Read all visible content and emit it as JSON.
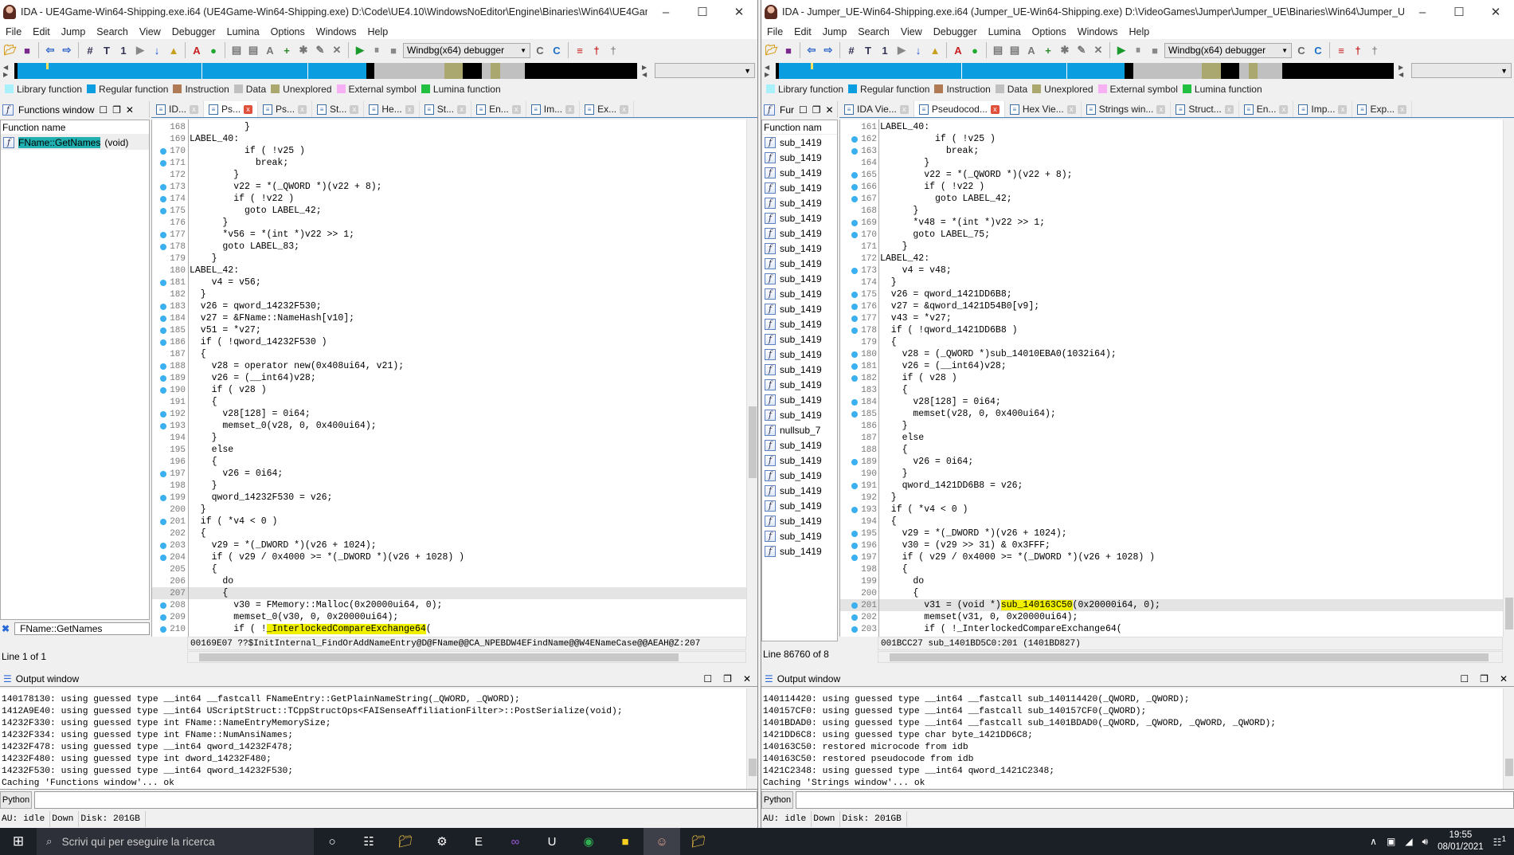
{
  "windows": [
    {
      "title": "IDA - UE4Game-Win64-Shipping.exe.i64 (UE4Game-Win64-Shipping.exe) D:\\Code\\UE4.10\\WindowsNoEditor\\Engine\\Binaries\\Win64\\UE4Game-Win...",
      "menu": [
        "File",
        "Edit",
        "Jump",
        "Search",
        "View",
        "Debugger",
        "Lumina",
        "Options",
        "Windows",
        "Help"
      ],
      "debugger": "Windbg(x64) debugger",
      "panel_title": "Functions window",
      "tabs": [
        {
          "label": "ID...",
          "icon": "ida-view-icon"
        },
        {
          "label": "Ps...",
          "icon": "pseudocode-icon",
          "active": true
        },
        {
          "label": "Ps...",
          "icon": "pseudocode-icon"
        },
        {
          "label": "St...",
          "icon": "strings-icon"
        },
        {
          "label": "He...",
          "icon": "hex-view-icon"
        },
        {
          "label": "St...",
          "icon": "structures-icon"
        },
        {
          "label": "En...",
          "icon": "enums-icon"
        },
        {
          "label": "Im...",
          "icon": "imports-icon"
        },
        {
          "label": "Ex...",
          "icon": "exports-icon"
        }
      ],
      "functions": {
        "header": "Function name",
        "items": [
          {
            "name": "FName::GetNames",
            "suffix": "(void)",
            "selected": true
          }
        ],
        "filter": "FName::GetNames",
        "line_info": "Line 1 of 1"
      },
      "code": [
        {
          "n": "168",
          "bp": false,
          "t": "          }"
        },
        {
          "n": "169",
          "bp": false,
          "t": "LABEL_40:"
        },
        {
          "n": "170",
          "bp": true,
          "t": "          if ( !v25 )"
        },
        {
          "n": "171",
          "bp": true,
          "t": "            break;"
        },
        {
          "n": "172",
          "bp": false,
          "t": "        }"
        },
        {
          "n": "173",
          "bp": true,
          "t": "        v22 = *(_QWORD *)(v22 + 8);"
        },
        {
          "n": "174",
          "bp": true,
          "t": "        if ( !v22 )"
        },
        {
          "n": "175",
          "bp": true,
          "t": "          goto LABEL_42;"
        },
        {
          "n": "176",
          "bp": false,
          "t": "      }"
        },
        {
          "n": "177",
          "bp": true,
          "t": "      *v56 = *(int *)v22 >> 1;"
        },
        {
          "n": "178",
          "bp": true,
          "t": "      goto LABEL_83;"
        },
        {
          "n": "179",
          "bp": false,
          "t": "    }"
        },
        {
          "n": "180",
          "bp": false,
          "t": "LABEL_42:"
        },
        {
          "n": "181",
          "bp": true,
          "t": "    v4 = v56;"
        },
        {
          "n": "182",
          "bp": false,
          "t": "  }"
        },
        {
          "n": "183",
          "bp": true,
          "t": "  v26 = qword_14232F530;"
        },
        {
          "n": "184",
          "bp": true,
          "t": "  v27 = &FName::NameHash[v10];"
        },
        {
          "n": "185",
          "bp": true,
          "t": "  v51 = *v27;"
        },
        {
          "n": "186",
          "bp": true,
          "t": "  if ( !qword_14232F530 )"
        },
        {
          "n": "187",
          "bp": false,
          "t": "  {"
        },
        {
          "n": "188",
          "bp": true,
          "t": "    v28 = operator new(0x408ui64, v21);"
        },
        {
          "n": "189",
          "bp": true,
          "t": "    v26 = (__int64)v28;"
        },
        {
          "n": "190",
          "bp": true,
          "t": "    if ( v28 )"
        },
        {
          "n": "191",
          "bp": false,
          "t": "    {"
        },
        {
          "n": "192",
          "bp": true,
          "t": "      v28[128] = 0i64;"
        },
        {
          "n": "193",
          "bp": true,
          "t": "      memset_0(v28, 0, 0x400ui64);"
        },
        {
          "n": "194",
          "bp": false,
          "t": "    }"
        },
        {
          "n": "195",
          "bp": false,
          "t": "    else"
        },
        {
          "n": "196",
          "bp": false,
          "t": "    {"
        },
        {
          "n": "197",
          "bp": true,
          "t": "      v26 = 0i64;"
        },
        {
          "n": "198",
          "bp": false,
          "t": "    }"
        },
        {
          "n": "199",
          "bp": true,
          "t": "    qword_14232F530 = v26;"
        },
        {
          "n": "200",
          "bp": false,
          "t": "  }"
        },
        {
          "n": "201",
          "bp": true,
          "t": "  if ( *v4 < 0 )"
        },
        {
          "n": "202",
          "bp": false,
          "t": "  {"
        },
        {
          "n": "203",
          "bp": true,
          "t": "    v29 = *(_DWORD *)(v26 + 1024);"
        },
        {
          "n": "204",
          "bp": true,
          "t": "    if ( v29 / 0x4000 >= *(_DWORD *)(v26 + 1028) )"
        },
        {
          "n": "205",
          "bp": false,
          "t": "    {"
        },
        {
          "n": "206",
          "bp": false,
          "t": "      do"
        },
        {
          "n": "207",
          "bp": false,
          "t": "      {",
          "current": true
        },
        {
          "n": "208",
          "bp": true,
          "t": "        v30 = FMemory::Malloc(0x20000ui64, 0);"
        },
        {
          "n": "209",
          "bp": true,
          "t": "        memset_0(v30, 0, 0x20000ui64);"
        },
        {
          "n": "210",
          "bp": true,
          "t": "        if ( !_InterlockedCompareExchange64(",
          "hl": "_InterlockedCompareExchange64"
        }
      ],
      "code_status": "00169E07 ??$InitInternal_FindOrAddNameEntry@D@FName@@CA_NPEBDW4EFindName@@W4ENameCase@@AEAH@Z:207",
      "output_title": "Output window",
      "output": [
        "140178130: using guessed type __int64 __fastcall FNameEntry::GetPlainNameString(_QWORD, _QWORD);",
        "1412A9E40: using guessed type __int64 UScriptStruct::TCppStructOps<FAISenseAffiliationFilter>::PostSerialize(void);",
        "14232F330: using guessed type int FName::NameEntryMemorySize;",
        "14232F334: using guessed type int FName::NumAnsiNames;",
        "14232F478: using guessed type __int64 qword_14232F478;",
        "14232F480: using guessed type int dword_14232F480;",
        "14232F530: using guessed type __int64 qword_14232F530;",
        "Caching 'Functions window'... ok"
      ],
      "python_label": "Python",
      "status": [
        "AU:  idle",
        "Down",
        "Disk: 201GB"
      ]
    },
    {
      "title": "IDA - Jumper_UE-Win64-Shipping.exe.i64 (Jumper_UE-Win64-Shipping.exe) D:\\VideoGames\\Jumper\\Jumper_UE\\Binaries\\Win64\\Jumper_UE-Win64-...",
      "menu": [
        "File",
        "Edit",
        "Jump",
        "Search",
        "View",
        "Debugger",
        "Lumina",
        "Options",
        "Windows",
        "Help"
      ],
      "debugger": "Windbg(x64) debugger",
      "panel_title": "Fur",
      "tabs": [
        {
          "label": "IDA Vie...",
          "icon": "ida-view-icon"
        },
        {
          "label": "Pseudocod...",
          "icon": "pseudocode-icon",
          "active": true
        },
        {
          "label": "Hex Vie...",
          "icon": "hex-view-icon"
        },
        {
          "label": "Strings win...",
          "icon": "strings-icon"
        },
        {
          "label": "Struct...",
          "icon": "structures-icon"
        },
        {
          "label": "En...",
          "icon": "enums-icon"
        },
        {
          "label": "Imp...",
          "icon": "imports-icon"
        },
        {
          "label": "Exp...",
          "icon": "exports-icon"
        }
      ],
      "functions": {
        "header": "Function nam",
        "items": [
          {
            "name": "sub_1419"
          },
          {
            "name": "sub_1419"
          },
          {
            "name": "sub_1419"
          },
          {
            "name": "sub_1419"
          },
          {
            "name": "sub_1419"
          },
          {
            "name": "sub_1419"
          },
          {
            "name": "sub_1419"
          },
          {
            "name": "sub_1419"
          },
          {
            "name": "sub_1419"
          },
          {
            "name": "sub_1419"
          },
          {
            "name": "sub_1419"
          },
          {
            "name": "sub_1419"
          },
          {
            "name": "sub_1419"
          },
          {
            "name": "sub_1419"
          },
          {
            "name": "sub_1419"
          },
          {
            "name": "sub_1419"
          },
          {
            "name": "sub_1419"
          },
          {
            "name": "sub_1419"
          },
          {
            "name": "sub_1419"
          },
          {
            "name": "nullsub_7"
          },
          {
            "name": "sub_1419"
          },
          {
            "name": "sub_1419"
          },
          {
            "name": "sub_1419"
          },
          {
            "name": "sub_1419"
          },
          {
            "name": "sub_1419"
          },
          {
            "name": "sub_1419"
          },
          {
            "name": "sub_1419"
          },
          {
            "name": "sub_1419"
          }
        ],
        "line_info": "Line 86760 of 8"
      },
      "code": [
        {
          "n": "161",
          "bp": false,
          "t": "LABEL_40:"
        },
        {
          "n": "162",
          "bp": true,
          "t": "          if ( !v25 )"
        },
        {
          "n": "163",
          "bp": true,
          "t": "            break;"
        },
        {
          "n": "164",
          "bp": false,
          "t": "        }"
        },
        {
          "n": "165",
          "bp": true,
          "t": "        v22 = *(_QWORD *)(v22 + 8);"
        },
        {
          "n": "166",
          "bp": true,
          "t": "        if ( !v22 )"
        },
        {
          "n": "167",
          "bp": true,
          "t": "          goto LABEL_42;"
        },
        {
          "n": "168",
          "bp": false,
          "t": "      }"
        },
        {
          "n": "169",
          "bp": true,
          "t": "      *v48 = *(int *)v22 >> 1;"
        },
        {
          "n": "170",
          "bp": true,
          "t": "      goto LABEL_75;"
        },
        {
          "n": "171",
          "bp": false,
          "t": "    }"
        },
        {
          "n": "172",
          "bp": false,
          "t": "LABEL_42:"
        },
        {
          "n": "173",
          "bp": true,
          "t": "    v4 = v48;"
        },
        {
          "n": "174",
          "bp": false,
          "t": "  }"
        },
        {
          "n": "175",
          "bp": true,
          "t": "  v26 = qword_1421DD6B8;"
        },
        {
          "n": "176",
          "bp": true,
          "t": "  v27 = &qword_1421D54B0[v9];"
        },
        {
          "n": "177",
          "bp": true,
          "t": "  v43 = *v27;"
        },
        {
          "n": "178",
          "bp": true,
          "t": "  if ( !qword_1421DD6B8 )"
        },
        {
          "n": "179",
          "bp": false,
          "t": "  {"
        },
        {
          "n": "180",
          "bp": true,
          "t": "    v28 = (_QWORD *)sub_14010EBA0(1032i64);"
        },
        {
          "n": "181",
          "bp": true,
          "t": "    v26 = (__int64)v28;"
        },
        {
          "n": "182",
          "bp": true,
          "t": "    if ( v28 )"
        },
        {
          "n": "183",
          "bp": false,
          "t": "    {"
        },
        {
          "n": "184",
          "bp": true,
          "t": "      v28[128] = 0i64;"
        },
        {
          "n": "185",
          "bp": true,
          "t": "      memset(v28, 0, 0x400ui64);"
        },
        {
          "n": "186",
          "bp": false,
          "t": "    }"
        },
        {
          "n": "187",
          "bp": false,
          "t": "    else"
        },
        {
          "n": "188",
          "bp": false,
          "t": "    {"
        },
        {
          "n": "189",
          "bp": true,
          "t": "      v26 = 0i64;"
        },
        {
          "n": "190",
          "bp": false,
          "t": "    }"
        },
        {
          "n": "191",
          "bp": true,
          "t": "    qword_1421DD6B8 = v26;"
        },
        {
          "n": "192",
          "bp": false,
          "t": "  }"
        },
        {
          "n": "193",
          "bp": true,
          "t": "  if ( *v4 < 0 )"
        },
        {
          "n": "194",
          "bp": false,
          "t": "  {"
        },
        {
          "n": "195",
          "bp": true,
          "t": "    v29 = *(_DWORD *)(v26 + 1024);"
        },
        {
          "n": "196",
          "bp": true,
          "t": "    v30 = (v29 >> 31) & 0x3FFF;"
        },
        {
          "n": "197",
          "bp": true,
          "t": "    if ( v29 / 0x4000 >= *(_DWORD *)(v26 + 1028) )"
        },
        {
          "n": "198",
          "bp": false,
          "t": "    {"
        },
        {
          "n": "199",
          "bp": false,
          "t": "      do"
        },
        {
          "n": "200",
          "bp": false,
          "t": "      {"
        },
        {
          "n": "201",
          "bp": true,
          "t": "        v31 = (void *)sub_140163C50(0x20000i64, 0);",
          "current": true,
          "hl": "sub_140163C50"
        },
        {
          "n": "202",
          "bp": true,
          "t": "        memset(v31, 0, 0x20000ui64);"
        },
        {
          "n": "203",
          "bp": true,
          "t": "        if ( !_InterlockedCompareExchange64("
        }
      ],
      "code_status": "001BCC27 sub_1401BD5C0:201 (1401BD827)",
      "output_title": "Output window",
      "output": [
        "140114420: using guessed type __int64 __fastcall sub_140114420(_QWORD, _QWORD);",
        "140157CF0: using guessed type __int64 __fastcall sub_140157CF0(_QWORD);",
        "1401BDAD0: using guessed type __int64 __fastcall sub_1401BDAD0(_QWORD, _QWORD, _QWORD, _QWORD);",
        "1421DD6C8: using guessed type char byte_1421DD6C8;",
        "140163C50: restored microcode from idb",
        "140163C50: restored pseudocode from idb",
        "1421C2348: using guessed type __int64 qword_1421C2348;",
        "Caching 'Strings window'... ok"
      ],
      "python_label": "Python",
      "status": [
        "AU:  idle",
        "Down",
        "Disk: 201GB"
      ]
    }
  ],
  "legend": [
    {
      "label": "Library function",
      "color": "#a8f0fa"
    },
    {
      "label": "Regular function",
      "color": "#0a9ee0"
    },
    {
      "label": "Instruction",
      "color": "#b07a55"
    },
    {
      "label": "Data",
      "color": "#c0c0c0"
    },
    {
      "label": "Unexplored",
      "color": "#aaa86e"
    },
    {
      "label": "External symbol",
      "color": "#f8b0f4"
    },
    {
      "label": "Lumina function",
      "color": "#22c040"
    }
  ],
  "taskbar": {
    "search_placeholder": "Scrivi qui per eseguire la ricerca",
    "apps": [
      "cortana-icon",
      "task-view-icon",
      "file-explorer-icon",
      "steam-icon",
      "epic-games-icon",
      "visual-studio-icon",
      "unreal-engine-icon",
      "chrome-icon",
      "sticky-notes-icon",
      "ida-icon",
      "folder-icon"
    ],
    "time": "19:55",
    "date": "08/01/2021",
    "notification_count": "1"
  }
}
